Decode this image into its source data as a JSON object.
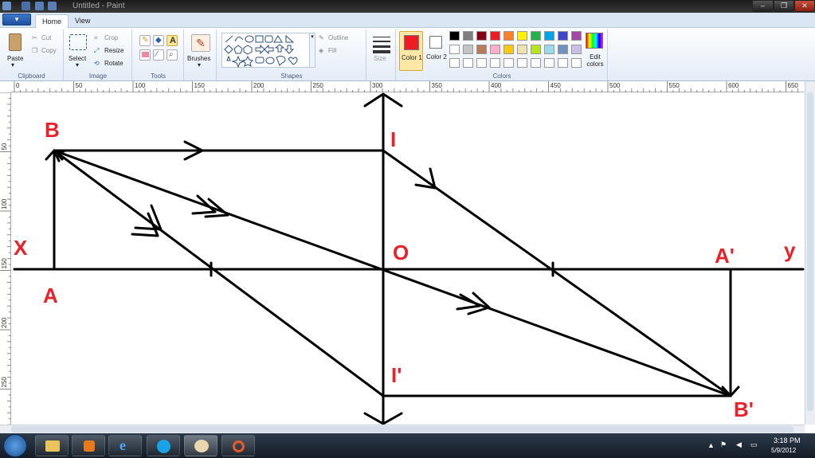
{
  "window": {
    "title": "Untitled - Paint"
  },
  "window_buttons": {
    "minimize": "–",
    "maximize": "❐",
    "close": "✕"
  },
  "menu": {
    "label": "▾"
  },
  "tabs": [
    {
      "label": "Home"
    },
    {
      "label": "View"
    }
  ],
  "ribbon": {
    "clipboard": {
      "label": "Clipboard",
      "paste": "Paste",
      "cut": "Cut",
      "copy": "Copy"
    },
    "image": {
      "label": "Image",
      "select": "Select",
      "crop": "Crop",
      "resize": "Resize",
      "rotate": "Rotate"
    },
    "tools": {
      "label": "Tools"
    },
    "brushes": {
      "label": "Brushes"
    },
    "shapes": {
      "label": "Shapes",
      "outline": "Outline",
      "fill": "Fill"
    },
    "size": {
      "label": "Size"
    },
    "colors": {
      "label": "Colors",
      "color1": "Color 1",
      "color2": "Color 2",
      "edit": "Edit colors",
      "color1_value": "#ed1c24",
      "color2_value": "#ffffff",
      "palette": [
        "#000000",
        "#7f7f7f",
        "#880015",
        "#ed1c24",
        "#ff7f27",
        "#fff200",
        "#22b14c",
        "#00a2e8",
        "#3f48cc",
        "#a349a4",
        "#ffffff",
        "#c3c3c3",
        "#b97a57",
        "#ffaec9",
        "#ffc90e",
        "#efe4b0",
        "#b5e61d",
        "#99d9ea",
        "#7092be",
        "#c8bfe7"
      ]
    }
  },
  "ruler": {
    "horizontal": [
      "0",
      "50",
      "100",
      "150",
      "200",
      "250",
      "300",
      "350",
      "400",
      "450",
      "500",
      "550",
      "600",
      "650"
    ],
    "vertical": [
      "50",
      "100",
      "150",
      "200",
      "250"
    ]
  },
  "drawing": {
    "labels": {
      "B": "B",
      "A": "A",
      "X": "X",
      "I": "I",
      "O": "O",
      "A_prime": "A'",
      "Y": "y",
      "I_prime": "I'",
      "B_prime": "B'"
    },
    "stroke_color": "#000000",
    "label_color": "#e8222a"
  },
  "taskbar": {
    "time": "3:18 PM",
    "date": "5/9/2012"
  },
  "icons": [
    "windows-start-icon",
    "explorer-icon",
    "media-player-icon",
    "internet-explorer-icon",
    "skype-icon",
    "paint-icon",
    "app-icon"
  ]
}
